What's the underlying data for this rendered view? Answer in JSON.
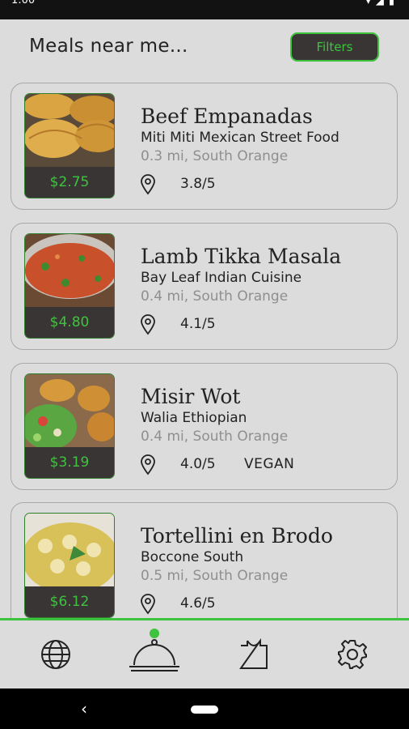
{
  "status_bar": {
    "time": "1:00",
    "icons": [
      "wifi-icon",
      "signal-icon",
      "battery-icon"
    ]
  },
  "header": {
    "title": "Meals near me...",
    "filters_label": "Filters"
  },
  "meals": [
    {
      "name": "Beef Empanadas",
      "restaurant": "Miti Miti Mexican Street Food",
      "distance": "0.3 mi, South Orange",
      "rating": "3.8/5",
      "tag": "",
      "price": "$2.75",
      "image": "empanadas-photo"
    },
    {
      "name": "Lamb Tikka Masala",
      "restaurant": "Bay Leaf Indian Cuisine",
      "distance": "0.4 mi, South Orange",
      "rating": "4.1/5",
      "tag": "",
      "price": "$4.80",
      "image": "tikka-masala-photo"
    },
    {
      "name": "Misir Wot",
      "restaurant": "Walia Ethiopian",
      "distance": "0.4 mi, South Orange",
      "rating": "4.0/5",
      "tag": "VEGAN",
      "price": "$3.19",
      "image": "misir-wot-photo"
    },
    {
      "name": "Tortellini en Brodo",
      "restaurant": "Boccone South",
      "distance": "0.5 mi, South Orange",
      "rating": "4.6/5",
      "tag": "",
      "price": "$6.12",
      "image": "tortellini-photo"
    }
  ],
  "tabs": [
    {
      "icon": "globe-icon",
      "active": false
    },
    {
      "icon": "cloche-icon",
      "active": true
    },
    {
      "icon": "bag-icon",
      "active": false
    },
    {
      "icon": "gear-icon",
      "active": false
    }
  ],
  "colors": {
    "accent": "#3ec33e",
    "dark": "#3a3535",
    "background": "#dcdcdc"
  }
}
